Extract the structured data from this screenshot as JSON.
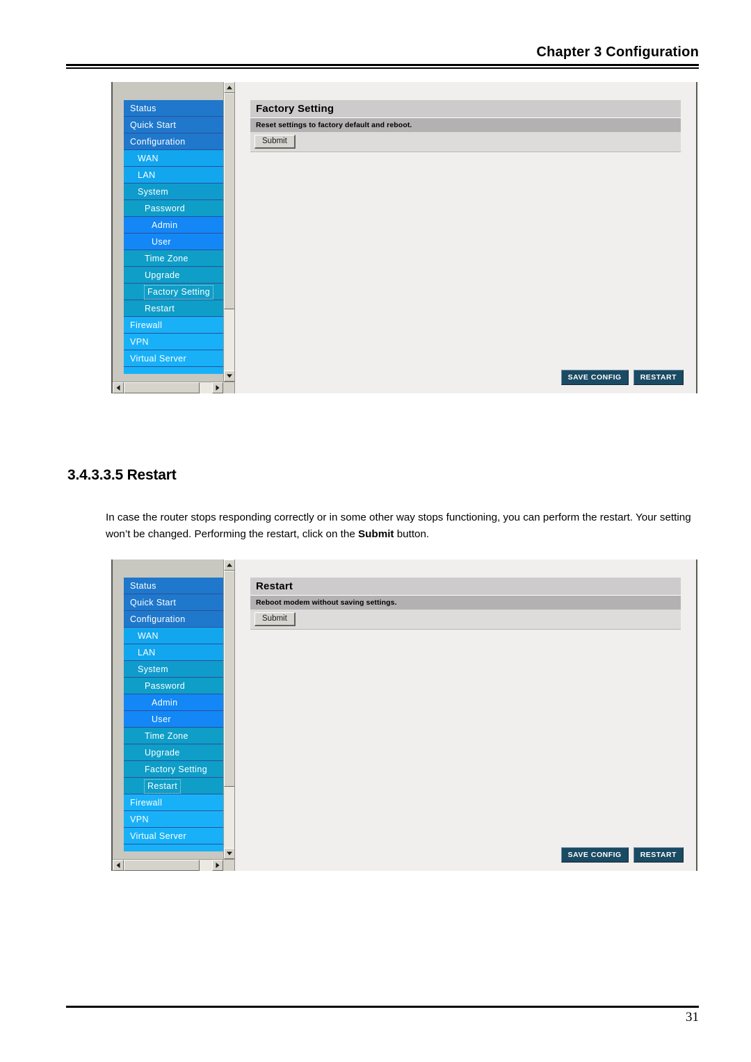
{
  "header": {
    "chapter_title": "Chapter 3 Configuration"
  },
  "footer": {
    "page_number": "31"
  },
  "section": {
    "heading": "3.4.3.3.5 Restart",
    "paragraph_part1": "In case the router stops responding correctly or in some other way stops functioning, you can perform the restart. Your setting won’t be changed. Performing the restart, click on the ",
    "paragraph_bold": "Submit",
    "paragraph_part2": " button."
  },
  "nav_menu": {
    "items": [
      {
        "label": "Status",
        "level": "lvl0"
      },
      {
        "label": "Quick Start",
        "level": "lvl0"
      },
      {
        "label": "Configuration",
        "level": "lvl0"
      },
      {
        "label": "WAN",
        "level": "lvl1"
      },
      {
        "label": "LAN",
        "level": "lvl1"
      },
      {
        "label": "System",
        "level": "lvl1b"
      },
      {
        "label": "Password",
        "level": "lvl2"
      },
      {
        "label": "Admin",
        "level": "lvl3"
      },
      {
        "label": "User",
        "level": "lvl3"
      },
      {
        "label": "Time Zone",
        "level": "lvl2"
      },
      {
        "label": "Upgrade",
        "level": "lvl2"
      },
      {
        "label": "Factory Setting",
        "level": "lvl2"
      },
      {
        "label": "Restart",
        "level": "lvl2"
      },
      {
        "label": "Firewall",
        "level": "lvl1c"
      },
      {
        "label": "VPN",
        "level": "lvl1c"
      },
      {
        "label": "Virtual Server",
        "level": "lvl1c"
      }
    ]
  },
  "screenshot_factory": {
    "panel_title": "Factory Setting",
    "panel_description": "Reset settings to factory default and reboot.",
    "submit_label": "Submit",
    "save_config_label": "SAVE CONFIG",
    "restart_label": "RESTART",
    "active_item": "Factory Setting"
  },
  "screenshot_restart": {
    "panel_title": "Restart",
    "panel_description": "Reboot modem without saving settings.",
    "submit_label": "Submit",
    "save_config_label": "SAVE CONFIG",
    "restart_label": "RESTART",
    "active_item": "Restart"
  },
  "colors": {
    "nav_level0": "#1f78cc",
    "nav_level1": "#12a6ef",
    "nav_level2": "#0e9ec8",
    "nav_level3": "#1287f5",
    "panel_title_bg": "#cdcbcb",
    "panel_desc_bg": "#b3b1b1",
    "nav_button_bg": "#1b4a63",
    "content_bg": "#f1eeee"
  }
}
